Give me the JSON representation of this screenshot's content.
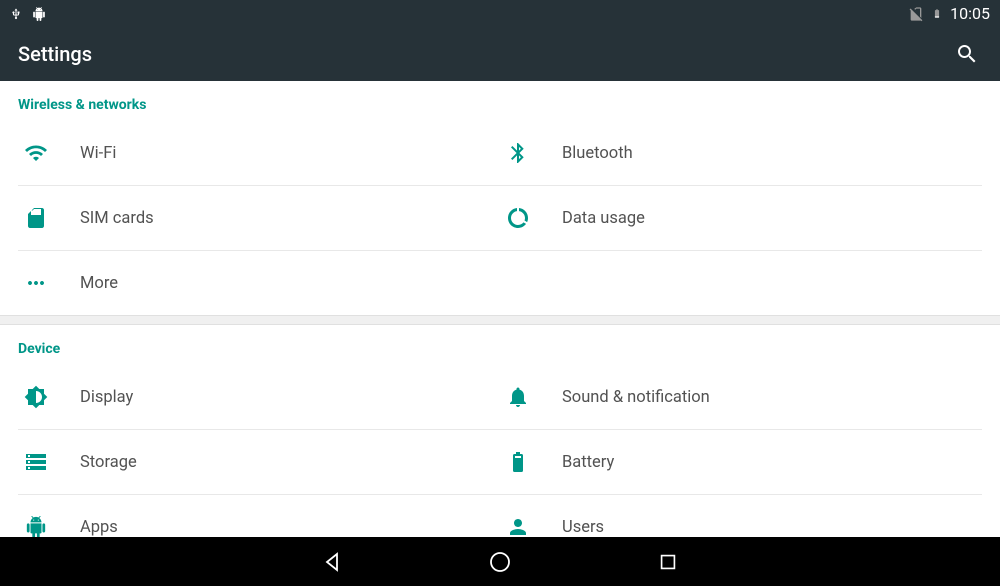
{
  "status": {
    "time": "10:05"
  },
  "app": {
    "title": "Settings"
  },
  "sections": {
    "wireless": {
      "header": "Wireless & networks",
      "wifi": "Wi-Fi",
      "bluetooth": "Bluetooth",
      "sim": "SIM cards",
      "data": "Data usage",
      "more": "More"
    },
    "device": {
      "header": "Device",
      "display": "Display",
      "sound": "Sound & notification",
      "storage": "Storage",
      "battery": "Battery",
      "apps": "Apps",
      "users": "Users"
    }
  },
  "colors": {
    "accent": "#009688",
    "header_bg": "#263238"
  }
}
